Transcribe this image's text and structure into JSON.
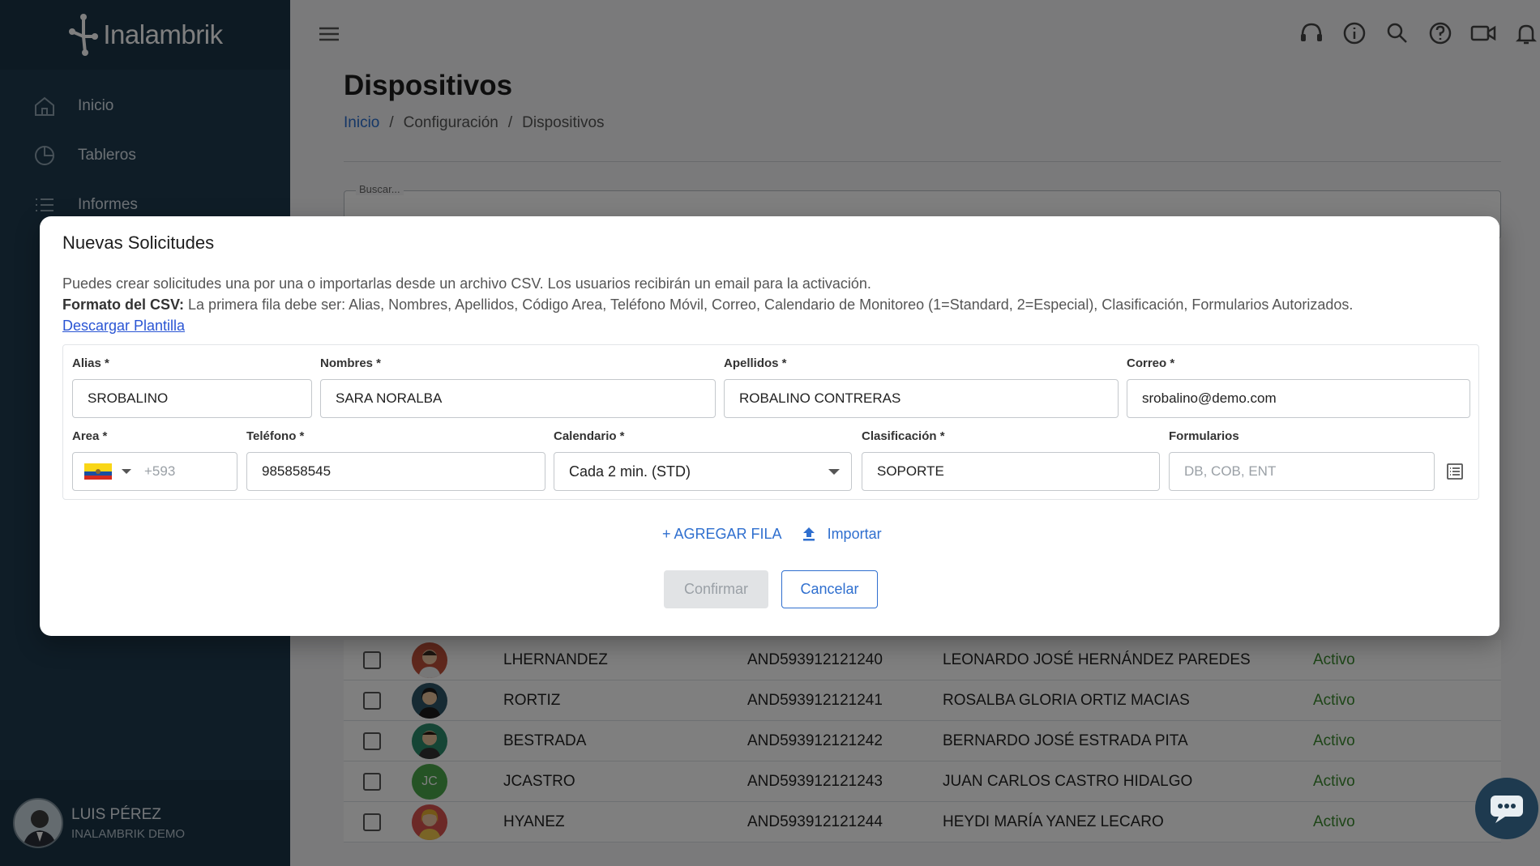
{
  "app": {
    "logo_text": "Inalambrik"
  },
  "sidebar": {
    "items": [
      {
        "label": "Inicio",
        "icon": "home-icon"
      },
      {
        "label": "Tableros",
        "icon": "pie-chart-icon"
      },
      {
        "label": "Informes",
        "icon": "list-icon"
      }
    ],
    "user": {
      "name": "LUIS PÉREZ",
      "org": "INALAMBRIK DEMO"
    }
  },
  "header": {
    "icons": [
      "support-icon",
      "info-icon",
      "search-icon",
      "help-icon",
      "video-icon",
      "bell-icon"
    ]
  },
  "page": {
    "title": "Dispositivos",
    "breadcrumb": [
      "Inicio",
      "/",
      "Configuración",
      "/",
      "Dispositivos"
    ],
    "search_label": "Buscar..."
  },
  "table": {
    "rows": [
      {
        "alias": "LHERNANDEZ",
        "id": "AND593912121240",
        "name": "LEONARDO JOSÉ HERNÁNDEZ PAREDES",
        "status": "Activo",
        "avatar_color": "#c0503a",
        "initials": ""
      },
      {
        "alias": "RORTIZ",
        "id": "AND593912121241",
        "name": "ROSALBA GLORIA ORTIZ MACIAS",
        "status": "Activo",
        "avatar_color": "#2d5566",
        "initials": ""
      },
      {
        "alias": "BESTRADA",
        "id": "AND593912121242",
        "name": "BERNARDO JOSÉ ESTRADA PITA",
        "status": "Activo",
        "avatar_color": "#2a8a6a",
        "initials": ""
      },
      {
        "alias": "JCASTRO",
        "id": "AND593912121243",
        "name": "JUAN CARLOS CASTRO HIDALGO",
        "status": "Activo",
        "avatar_color": "#4aa64a",
        "initials": "JC"
      },
      {
        "alias": "HYANEZ",
        "id": "AND593912121244",
        "name": "HEYDI MARÍA YANEZ LECARO",
        "status": "Activo",
        "avatar_color": "#d9534f",
        "initials": ""
      }
    ]
  },
  "modal": {
    "title": "Nuevas Solicitudes",
    "desc_line1": "Puedes crear solicitudes una por una o importarlas desde un archivo CSV. Los usuarios recibirán un email para la activación.",
    "desc_bold": "Formato del CSV:",
    "desc_line2": " La primera fila debe ser: Alias, Nombres, Apellidos, Código Area, Teléfono Móvil, Correo, Calendario de Monitoreo (1=Standard, 2=Especial), Clasificación, Formularios Autorizados.",
    "download_link": "Descargar Plantilla",
    "fields": {
      "alias": {
        "label": "Alias *",
        "value": "SROBALINO"
      },
      "nombres": {
        "label": "Nombres *",
        "value": "SARA NORALBA"
      },
      "apellidos": {
        "label": "Apellidos *",
        "value": "ROBALINO CONTRERAS"
      },
      "correo": {
        "label": "Correo *",
        "value": "srobalino@demo.com"
      },
      "area": {
        "label": "Area *",
        "placeholder": "+593"
      },
      "telefono": {
        "label": "Teléfono *",
        "value": "985858545"
      },
      "calendario": {
        "label": "Calendario *",
        "value": "Cada 2 min. (STD)"
      },
      "clasificacion": {
        "label": "Clasificación *",
        "value": "SOPORTE"
      },
      "formularios": {
        "label": "Formularios",
        "placeholder": "DB, COB, ENT"
      }
    },
    "add_row": "+ AGREGAR FILA",
    "import": "Importar",
    "confirm": "Confirmar",
    "cancel": "Cancelar"
  }
}
